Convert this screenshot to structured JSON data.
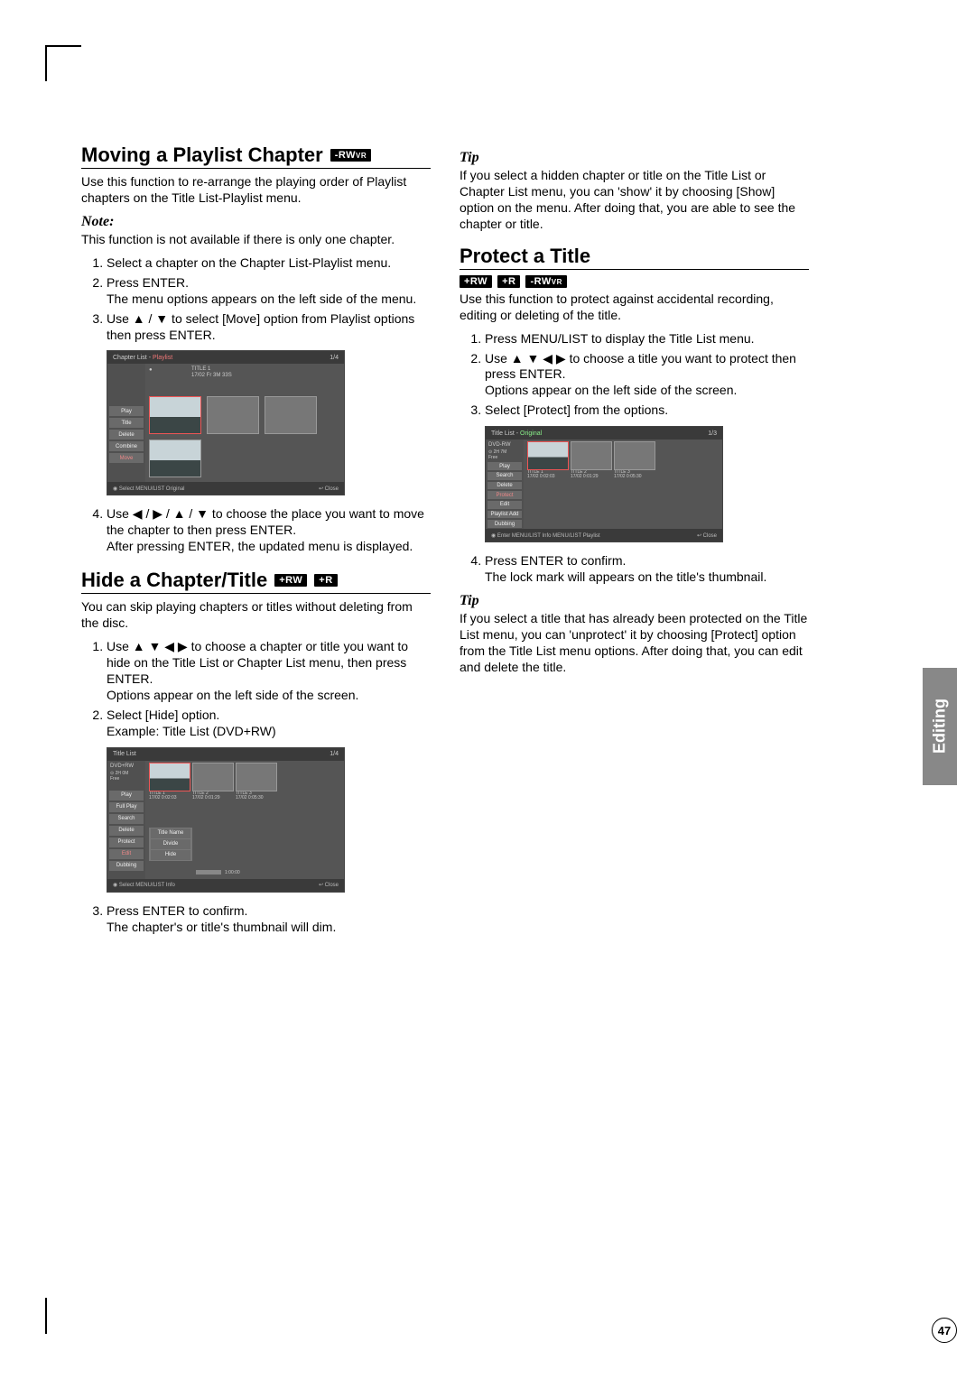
{
  "pageNumber": "47",
  "sideTab": "Editing",
  "badges": {
    "rwvr": "-RWVR",
    "plusrw": "+RW",
    "plusr": "+R"
  },
  "left": {
    "sec1": {
      "title": "Moving a Playlist Chapter",
      "intro": "Use this function to re-arrange the playing order of Playlist chapters on the Title List-Playlist menu.",
      "noteLabel": "Note:",
      "noteBody": "This function is not available if there is only one chapter.",
      "steps": [
        "Select a chapter on the Chapter List-Playlist menu.",
        "Press ENTER.\nThe menu options appears on the left side of the menu.",
        "Use ▲ / ▼ to select [Move] option from Playlist options then press ENTER."
      ],
      "step4": "Use ◀ / ▶ / ▲ / ▼ to choose the place you want to move the chapter to then press ENTER.\nAfter pressing ENTER, the updated menu is displayed."
    },
    "sec2": {
      "title": "Hide a Chapter/Title",
      "intro": "You can skip playing chapters or titles without deleting from the disc.",
      "steps": [
        "Use ▲ ▼ ◀ ▶ to choose a chapter or title you want to hide on the Title List or Chapter List menu, then press ENTER.\nOptions appear on the left side of the screen.",
        "Select [Hide] option.\nExample: Title List (DVD+RW)"
      ],
      "step3": "Press ENTER to confirm.\nThe chapter's or title's thumbnail will dim."
    }
  },
  "right": {
    "tip1Label": "Tip",
    "tip1Body": "If you select a hidden chapter or title on the Title List or Chapter List menu, you can 'show' it by choosing [Show] option on the menu. After doing that, you are able to see the chapter or title.",
    "sec3": {
      "title": "Protect a Title",
      "intro": "Use this function to protect against accidental recording, editing or deleting of the title.",
      "steps": [
        "Press MENU/LIST to display the Title List menu.",
        "Use ▲ ▼ ◀ ▶ to choose a title you want to protect then press ENTER.\nOptions appear on the left side of the screen.",
        "Select [Protect] from the options."
      ],
      "step4": "Press ENTER to confirm.\nThe lock mark will appears on the title's thumbnail."
    },
    "tip2Label": "Tip",
    "tip2Body": "If you select a title that has already been protected on the Title List menu, you can 'unprotect' it by choosing [Protect] option from the Title List menu options. After doing that, you can edit and delete the title."
  },
  "screenshots": {
    "chapterList": {
      "header": "Chapter List",
      "headerSuffix": "Playlist",
      "counter": "1/4",
      "info1": "TITLE 1",
      "info2": "17/02 Fr   3M 33S",
      "menu": [
        "Play",
        "Title",
        "Delete",
        "Combine",
        "Move"
      ],
      "footerL": "◉ Select  MENU/LIST Original",
      "footerR": "↩ Close"
    },
    "titleListRW": {
      "header": "Title List",
      "counter": "1/4",
      "topLabel": "DVD+RW",
      "cap": "2H 0M\nFree",
      "menu": [
        "Play",
        "Full Play",
        "Search",
        "Delete",
        "Protect",
        "Edit",
        "Dubbing"
      ],
      "submenu": [
        "Title Name",
        "Divide",
        "Hide"
      ],
      "cols": [
        {
          "t": "TITLE 1",
          "d": "17/02   0:02:03"
        },
        {
          "t": "TITLE 2",
          "d": "17/02   0:01:29"
        },
        {
          "t": "TITLE 3",
          "d": "17/02   0:05:30"
        }
      ],
      "extra": "1:00:00",
      "footerL": "◉ Select  MENU/LIST Info",
      "footerR": "↩ Close"
    },
    "titleListOriginal": {
      "header": "Title List",
      "headerSuffix": "Original",
      "counter": "1/3",
      "topLabel": "DVD-RW",
      "cap": "2H 7M\nFree",
      "menu": [
        "Play",
        "Search",
        "Delete",
        "Protect",
        "Edit",
        "Playlist Add",
        "Dubbing"
      ],
      "cols": [
        {
          "t": "TITLE 1",
          "d": "17/02   0:02:03"
        },
        {
          "t": "TITLE 2",
          "d": "17/02   0:01:29"
        },
        {
          "t": "TITLE 3",
          "d": "17/02   0:05:30"
        }
      ],
      "footerL": "◉ Enter  MENU/LIST Info  MENU/LIST Playlist",
      "footerR": "↩ Close"
    }
  }
}
